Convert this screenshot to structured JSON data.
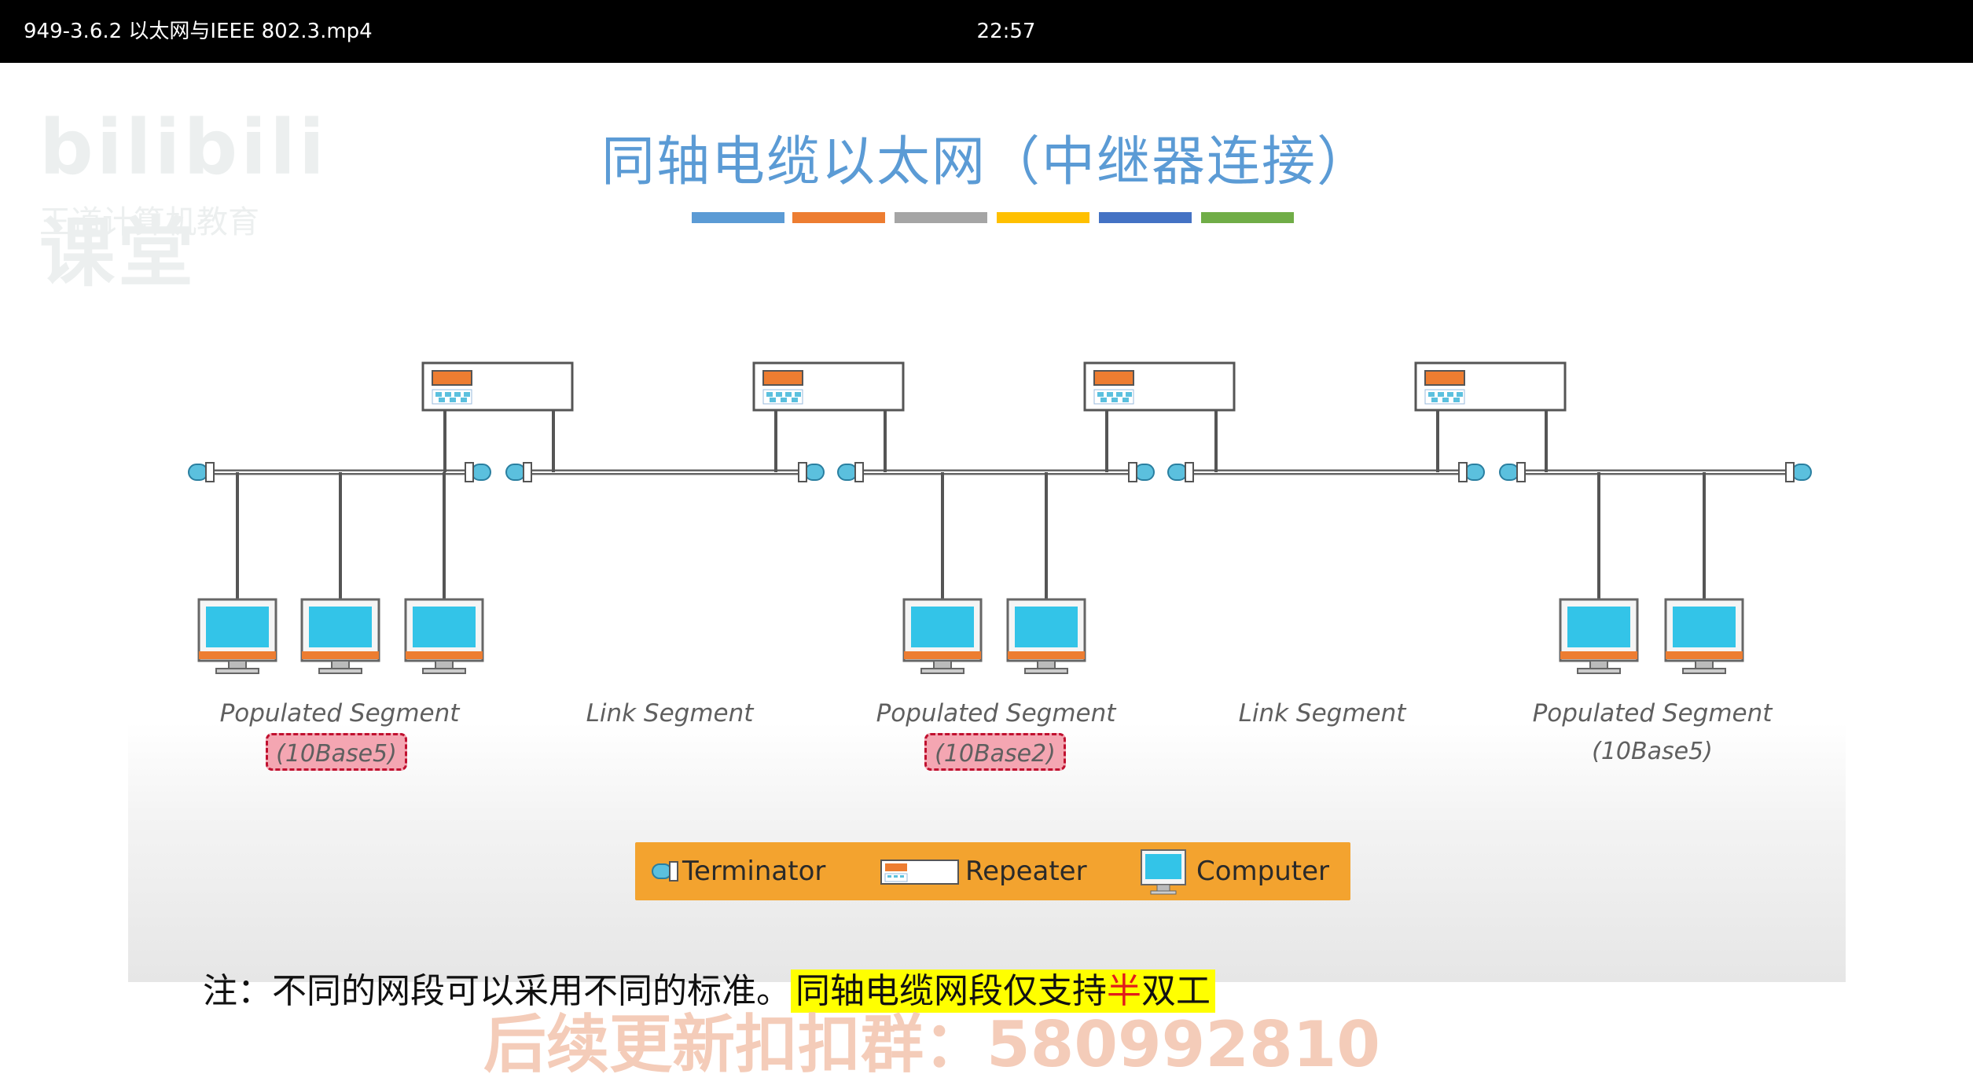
{
  "window": {
    "filename": "949-3.6.2 以太网与IEEE 802.3.mp4",
    "time": "22:57"
  },
  "logo": {
    "brand": "bilibili课堂",
    "subtitle": "王道计算机教育"
  },
  "slide": {
    "title": "同轴电缆以太网（中继器连接）",
    "title_color": "#5b9bd5",
    "accent_colors": [
      "#5b9bd5",
      "#ed7d31",
      "#a5a5a5",
      "#ffc000",
      "#4472c4",
      "#70ad47"
    ]
  },
  "segments": [
    {
      "label": "Populated Segment",
      "sub": "(10Base5)",
      "highlighted": true
    },
    {
      "label": "Link Segment"
    },
    {
      "label": "Populated Segment",
      "sub": "(10Base2)",
      "highlighted": true
    },
    {
      "label": "Link Segment"
    },
    {
      "label": "Populated Segment",
      "sub": "(10Base5)",
      "highlighted": false
    }
  ],
  "legend": {
    "terminator": "Terminator",
    "repeater": "Repeater",
    "computer": "Computer",
    "background": "#f3a32f"
  },
  "note": {
    "prefix": "注：不同的网段可以采用不同的标准。",
    "hl_a": "同轴电缆网段仅支持",
    "hl_red": "半",
    "hl_b": "双工"
  },
  "watermark": {
    "text": "后续更新扣扣群：580992810"
  }
}
